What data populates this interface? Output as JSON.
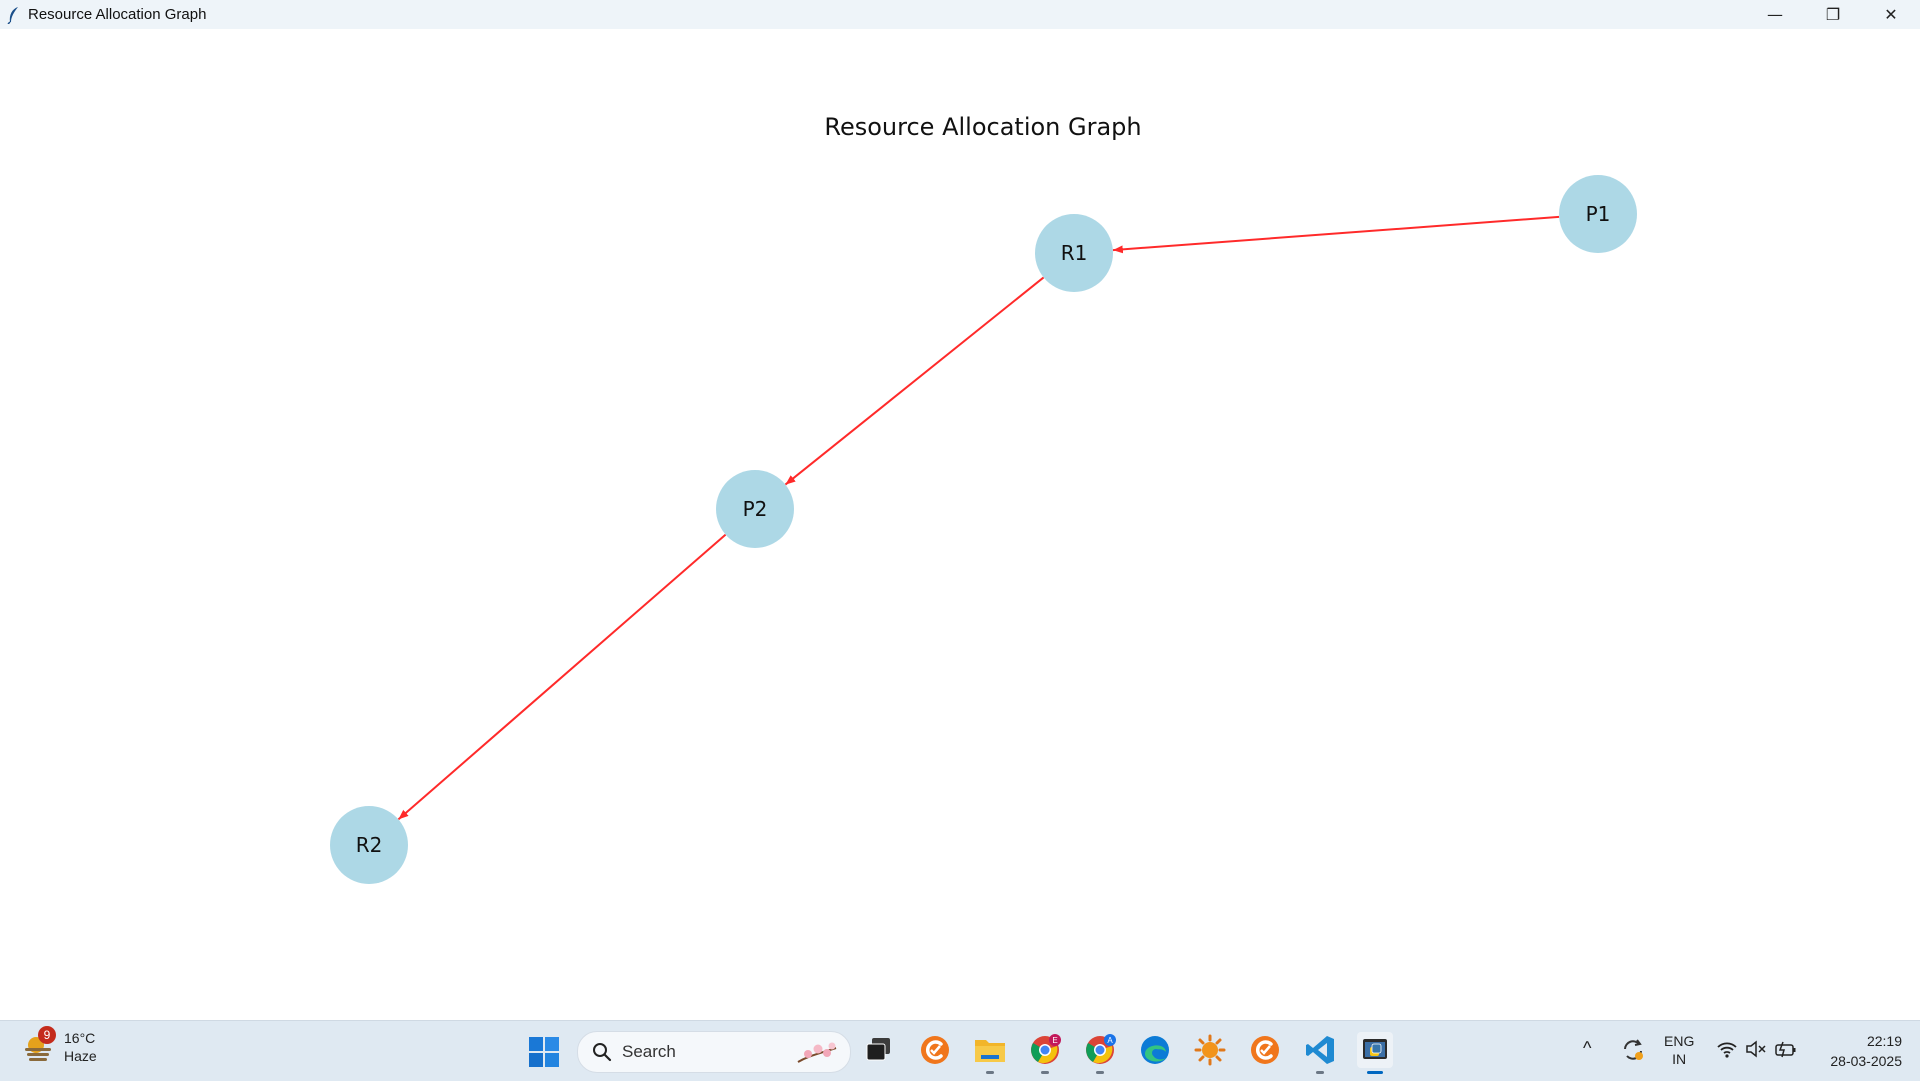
{
  "window": {
    "title": "Resource Allocation Graph",
    "controls": {
      "minimize": "—",
      "restore": "❐",
      "close": "✕"
    }
  },
  "graph": {
    "title": "Resource Allocation Graph",
    "node_color": "#add8e6",
    "edge_color": "#ff2a2a",
    "nodes": [
      {
        "id": "P1",
        "label": "P1"
      },
      {
        "id": "R1",
        "label": "R1"
      },
      {
        "id": "P2",
        "label": "P2"
      },
      {
        "id": "R2",
        "label": "R2"
      }
    ],
    "edges": [
      {
        "from": "P1",
        "to": "R1"
      },
      {
        "from": "R1",
        "to": "P2"
      },
      {
        "from": "P2",
        "to": "R2"
      }
    ]
  },
  "taskbar": {
    "weather": {
      "temperature": "16°C",
      "condition": "Haze",
      "badge": "9"
    },
    "search": {
      "placeholder": "Search"
    },
    "apps": [
      {
        "name": "task-view",
        "icon": "task-view-icon"
      },
      {
        "name": "app-orange",
        "icon": "orange-c-icon"
      },
      {
        "name": "file-explorer",
        "icon": "folder-icon"
      },
      {
        "name": "chrome-e",
        "icon": "chrome-icon",
        "badge": "E"
      },
      {
        "name": "chrome-a",
        "icon": "chrome-icon",
        "badge": "A"
      },
      {
        "name": "edge",
        "icon": "edge-icon"
      },
      {
        "name": "app-sun",
        "icon": "sun-icon"
      },
      {
        "name": "app-orange-2",
        "icon": "orange-c-icon"
      },
      {
        "name": "vscode",
        "icon": "vscode-icon"
      },
      {
        "name": "python",
        "icon": "python-icon"
      }
    ],
    "tray": {
      "chevron": "^",
      "lang_top": "ENG",
      "lang_bottom": "IN"
    },
    "clock": {
      "time": "22:19",
      "date": "28-03-2025"
    }
  }
}
